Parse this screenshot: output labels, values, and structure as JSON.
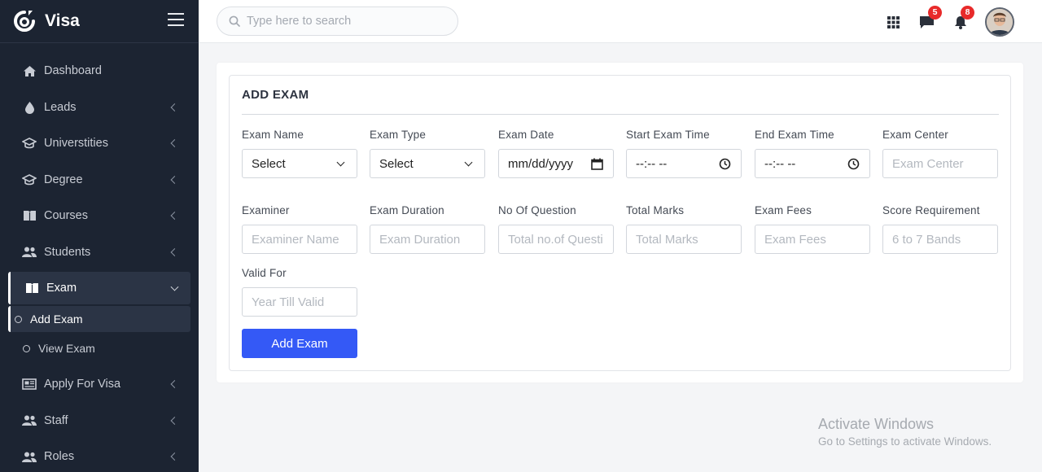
{
  "brand": {
    "name": "Visa",
    "logo": "visa-logo"
  },
  "search": {
    "placeholder": "Type here to search"
  },
  "header": {
    "icons": [
      "apps-grid-icon",
      "chat-icon",
      "bell-icon"
    ],
    "chat_badge": "5",
    "notification_badge": "8"
  },
  "sidebar": {
    "items": [
      {
        "label": "Dashboard",
        "icon": "home-icon"
      },
      {
        "label": "Leads",
        "icon": "drop-icon"
      },
      {
        "label": "Universtities",
        "icon": "graduation-cap-icon"
      },
      {
        "label": "Degree",
        "icon": "graduation-cap-icon"
      },
      {
        "label": "Courses",
        "icon": "book-icon"
      },
      {
        "label": "Students",
        "icon": "users-icon"
      },
      {
        "label": "Exam",
        "icon": "book-open-icon"
      },
      {
        "label": "Apply For Visa",
        "icon": "newspaper-icon"
      },
      {
        "label": "Staff",
        "icon": "users-icon"
      },
      {
        "label": "Roles",
        "icon": "users-icon"
      }
    ],
    "exam_sub": {
      "add": "Add Exam",
      "view": "View Exam"
    }
  },
  "form": {
    "title": "ADD EXAM",
    "exam_name": {
      "label": "Exam Name",
      "value": "Select"
    },
    "exam_type": {
      "label": "Exam Type",
      "value": "Select"
    },
    "exam_date": {
      "label": "Exam Date",
      "value": "mm/dd/yyyy"
    },
    "start_time": {
      "label": "Start Exam Time",
      "value": "--:-- --"
    },
    "end_time": {
      "label": "End Exam Time",
      "value": "--:-- --"
    },
    "exam_center": {
      "label": "Exam Center",
      "placeholder": "Exam Center"
    },
    "examiner": {
      "label": "Examiner",
      "placeholder": "Examiner Name"
    },
    "duration": {
      "label": "Exam Duration",
      "placeholder": "Exam Duration"
    },
    "questions": {
      "label": "No Of Question",
      "placeholder": "Total no.of Questi"
    },
    "marks": {
      "label": "Total Marks",
      "placeholder": "Total Marks"
    },
    "fees": {
      "label": "Exam Fees",
      "placeholder": "Exam Fees"
    },
    "score": {
      "label": "Score Requirement",
      "placeholder": "6 to 7 Bands"
    },
    "valid_for": {
      "label": "Valid For",
      "placeholder": "Year Till Valid"
    },
    "submit_label": "Add Exam"
  },
  "watermark": {
    "line1": "Activate Windows",
    "line2": "Go to Settings to activate Windows."
  },
  "colors": {
    "sidebar": "#1c2432",
    "accent": "#3459f6",
    "badge": "#e82a2a"
  }
}
